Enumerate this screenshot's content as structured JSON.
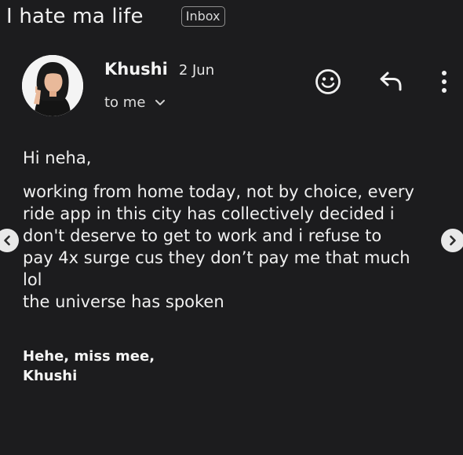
{
  "email": {
    "subject": "I hate ma life",
    "folder_label": "Inbox",
    "sender_name": "Khushi",
    "date": "2 Jun",
    "recipient_line": "to me",
    "greeting": "Hi neha,",
    "body": "working from home today, not by choice, every\nride app in this city has collectively decided i\ndon't deserve to get to work and i refuse to\npay 4x surge cus they don’t pay me that much\nlol\nthe universe has spoken",
    "signoff": "Hehe, miss mee,\nKhushi"
  },
  "icons": {
    "emoji": "smiley-icon",
    "reply": "reply-icon",
    "more": "more-vert-icon",
    "expand": "chevron-down-icon",
    "prev": "chevron-left-icon",
    "next": "chevron-right-icon"
  },
  "colors": {
    "background": "#1c1c1e",
    "text": "#f0f0f0",
    "chip_border": "#8e8e8e",
    "nav_button": "#e9e9e9"
  }
}
